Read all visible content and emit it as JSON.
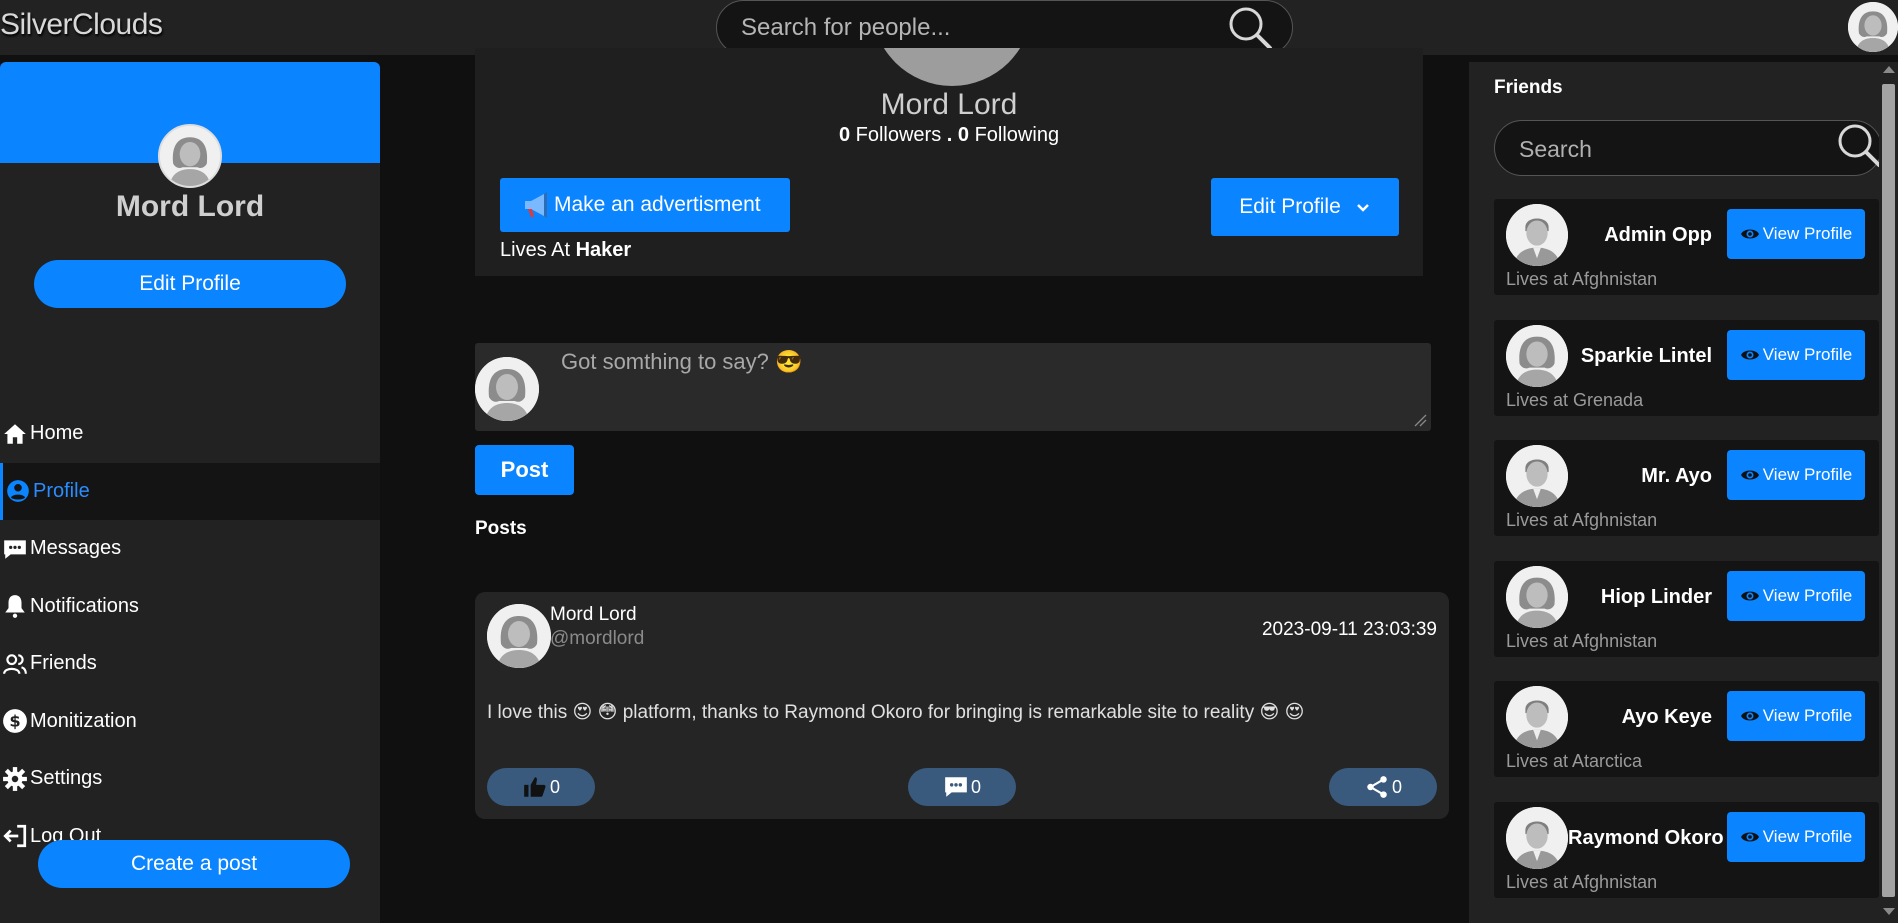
{
  "app": {
    "brand": "SilverClouds"
  },
  "topbar": {
    "search_placeholder": "Search for people..."
  },
  "sidebar": {
    "user_name": "Mord Lord",
    "edit_profile_label": "Edit Profile",
    "nav": [
      {
        "label": "Home",
        "icon": "home-icon"
      },
      {
        "label": "Profile",
        "icon": "user-circle-icon",
        "active": true
      },
      {
        "label": "Messages",
        "icon": "message-icon"
      },
      {
        "label": "Notifications",
        "icon": "bell-icon"
      },
      {
        "label": "Friends",
        "icon": "users-icon"
      },
      {
        "label": "Monitization",
        "icon": "dollar-icon"
      },
      {
        "label": "Settings",
        "icon": "gear-icon"
      },
      {
        "label": "Log Out",
        "icon": "logout-icon"
      }
    ],
    "create_post_label": "Create a post"
  },
  "profile": {
    "name": "Mord Lord",
    "followers_count": "0",
    "followers_label": "Followers",
    "separator": ".",
    "following_count": "0",
    "following_label": "Following",
    "advert_label": "Make an advertisment",
    "lives_prefix": "Lives At",
    "lives_place": "Haker",
    "edit_profile_label": "Edit Profile"
  },
  "composer": {
    "placeholder": "Got somthing to say? 😎",
    "post_label": "Post"
  },
  "posts_heading": "Posts",
  "posts": [
    {
      "author": "Mord Lord",
      "handle": "@mordlord",
      "date": "2023-09-11 23:03:39",
      "text": "I love this 😍 😳 platform, thanks to Raymond Okoro for bringing is remarkable site to reality 😎 😍",
      "likes": "0",
      "comments": "0",
      "shares": "0"
    }
  ],
  "friends_panel": {
    "title": "Friends",
    "search_placeholder": "Search",
    "view_label": "View Profile",
    "friends": [
      {
        "name": "Admin Opp",
        "lives": "Lives at Afghnistan",
        "avatar": "male"
      },
      {
        "name": "Sparkie Lintel",
        "lives": "Lives at Grenada",
        "avatar": "female"
      },
      {
        "name": "Mr. Ayo",
        "lives": "Lives at Afghnistan",
        "avatar": "male"
      },
      {
        "name": "Hiop Linder",
        "lives": "Lives at Afghnistan",
        "avatar": "female"
      },
      {
        "name": "Ayo Keye",
        "lives": "Lives at Atarctica",
        "avatar": "male"
      },
      {
        "name": "Raymond Okoro",
        "lives": "Lives at Afghnistan",
        "avatar": "male"
      }
    ]
  },
  "colors": {
    "accent": "#0a84ff",
    "panel": "#222222",
    "background": "#101010",
    "reaction": "#395a7d"
  }
}
